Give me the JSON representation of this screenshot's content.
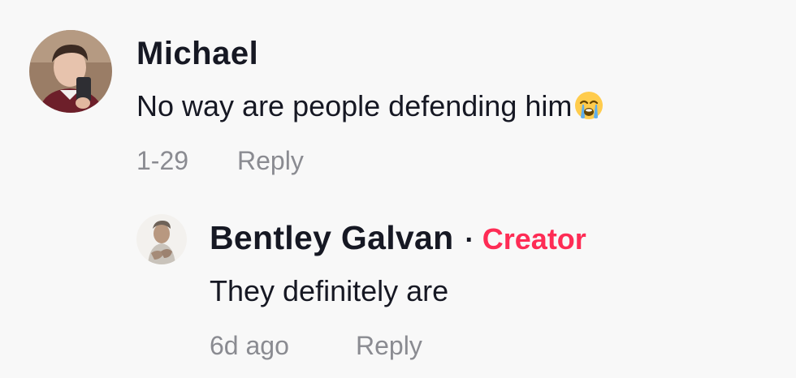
{
  "comment": {
    "username": "Michael",
    "text": "No way are people defending him",
    "emoji": "loudly-crying-face-icon",
    "date": "1-29",
    "reply_label": "Reply"
  },
  "reply": {
    "username": "Bentley Galvan",
    "separator": "·",
    "badge": "Creator",
    "text": "They definitely are",
    "date": "6d ago",
    "reply_label": "Reply"
  },
  "colors": {
    "background": "#f8f8f8",
    "text": "#161823",
    "meta": "#8a8b91",
    "creator_badge": "#fe2c55"
  }
}
